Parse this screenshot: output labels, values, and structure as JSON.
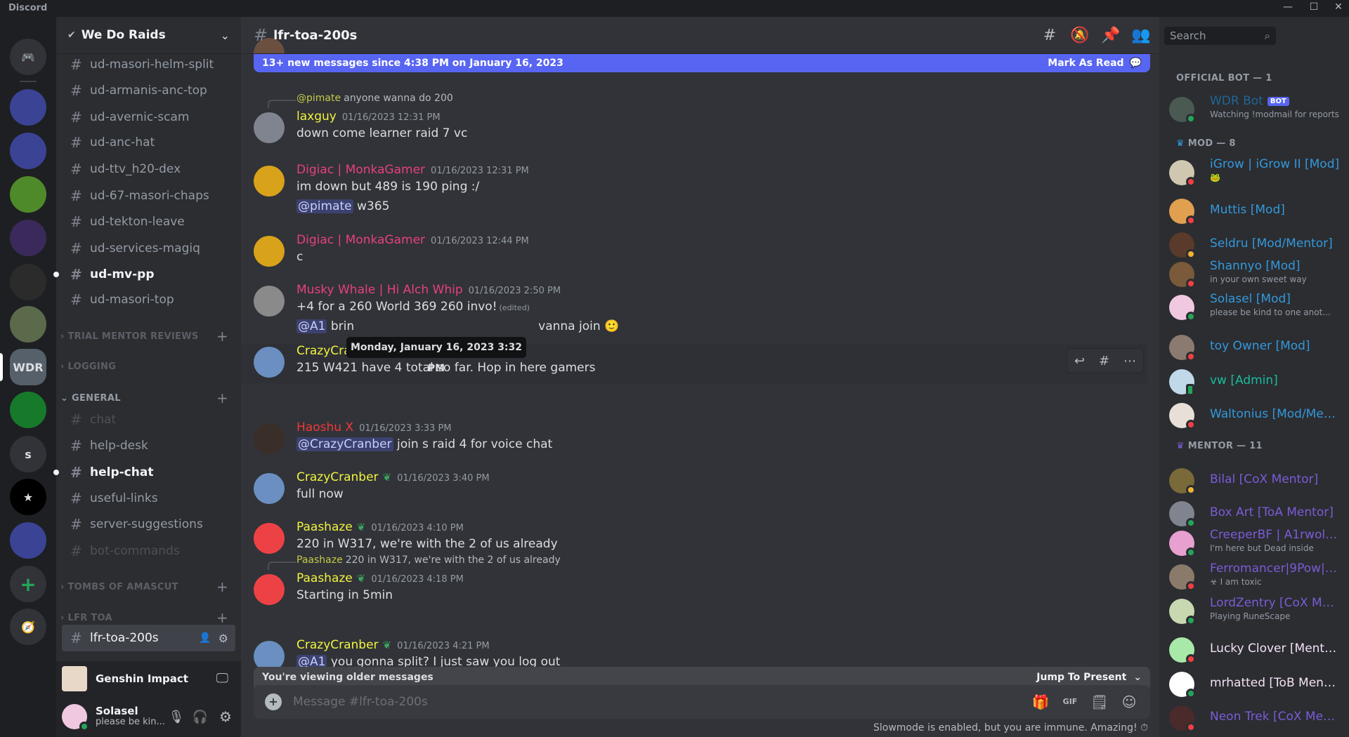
{
  "app": {
    "title": "Discord"
  },
  "colors": {
    "accent": "#5865f2",
    "online": "#23a55a",
    "dnd": "#f23f43",
    "idle": "#f0b232"
  },
  "servers": [
    {
      "name": "home",
      "icon": "discord-logo-icon",
      "color": "#313338",
      "label": ""
    },
    {
      "name": "folder-1",
      "icon": "server-folder-icon",
      "color": "#3b4395",
      "label": ""
    },
    {
      "name": "folder-2",
      "icon": "server-folder-icon",
      "color": "#3b4395",
      "label": ""
    },
    {
      "name": "corn-server",
      "icon": "server-image-icon",
      "color": "#4f8a2a",
      "label": ""
    },
    {
      "name": "kome-server",
      "icon": "server-image-icon",
      "color": "#3a2a5c",
      "label": ""
    },
    {
      "name": "helmet-server",
      "icon": "server-image-icon",
      "color": "#2b2b2b",
      "label": ""
    },
    {
      "name": "green-server",
      "icon": "server-image-icon",
      "color": "#5a6a4a",
      "label": ""
    },
    {
      "name": "We Do Raids",
      "icon": "server-image-icon",
      "color": "#55606a",
      "label": "WDR"
    },
    {
      "name": "brain-server",
      "icon": "server-image-icon",
      "color": "#177a2a",
      "label": ""
    },
    {
      "name": "s-server",
      "icon": "server-initial-icon",
      "color": "#313338",
      "label": "s"
    },
    {
      "name": "star-server",
      "icon": "server-image-icon",
      "color": "#000000",
      "label": "★"
    },
    {
      "name": "folder-3",
      "icon": "server-folder-icon",
      "color": "#3b4395",
      "label": ""
    },
    {
      "name": "add-server",
      "icon": "plus-icon",
      "color": "#313338",
      "label": "+"
    },
    {
      "name": "explore",
      "icon": "compass-icon",
      "color": "#313338",
      "label": "🧭"
    }
  ],
  "guild": {
    "name": "We Do Raids"
  },
  "channels": [
    {
      "type": "channel",
      "name": "ud-masori-helm-split",
      "state": "normal"
    },
    {
      "type": "channel",
      "name": "ud-armanis-anc-top",
      "state": "normal"
    },
    {
      "type": "channel",
      "name": "ud-avernic-scam",
      "state": "normal"
    },
    {
      "type": "channel",
      "name": "ud-anc-hat",
      "state": "normal"
    },
    {
      "type": "channel",
      "name": "ud-ttv_h20-dex",
      "state": "normal"
    },
    {
      "type": "channel",
      "name": "ud-67-masori-chaps",
      "state": "normal"
    },
    {
      "type": "channel",
      "name": "ud-tekton-leave",
      "state": "normal"
    },
    {
      "type": "channel",
      "name": "ud-services-magiq",
      "state": "normal"
    },
    {
      "type": "channel",
      "name": "ud-mv-pp",
      "state": "unread"
    },
    {
      "type": "channel",
      "name": "ud-masori-top",
      "state": "normal"
    },
    {
      "type": "category",
      "name": "TRIAL MENTOR REVIEWS",
      "collapsed": true
    },
    {
      "type": "category",
      "name": "LOGGING",
      "collapsed": true
    },
    {
      "type": "category",
      "name": "GENERAL",
      "collapsed": false
    },
    {
      "type": "channel",
      "name": "chat",
      "state": "muted"
    },
    {
      "type": "channel",
      "name": "help-desk",
      "state": "normal"
    },
    {
      "type": "channel",
      "name": "help-chat",
      "state": "unread"
    },
    {
      "type": "channel",
      "name": "useful-links",
      "state": "normal"
    },
    {
      "type": "channel",
      "name": "server-suggestions",
      "state": "normal"
    },
    {
      "type": "channel",
      "name": "bot-commands",
      "state": "muted"
    },
    {
      "type": "category",
      "name": "TOMBS OF AMASCUT",
      "collapsed": true
    },
    {
      "type": "category",
      "name": "LFR TOA",
      "collapsed": true
    },
    {
      "type": "channel",
      "name": "lfr-toa-200s",
      "state": "selected"
    }
  ],
  "activity": {
    "game": "Genshin Impact"
  },
  "user": {
    "name": "Solasel",
    "status": "please be kin..."
  },
  "header": {
    "channel": "lfr-toa-200s",
    "search_placeholder": "Search"
  },
  "banner": {
    "text": "13+ new messages since 4:38 PM on January 16, 2023",
    "action": "Mark As Read"
  },
  "messages": [
    {
      "author": "",
      "lines": [
        {
          "text": "anyone wanna do 200"
        }
      ],
      "avatar_color": "#6b4f3f"
    },
    {
      "reply": {
        "author": "@pimate",
        "color": "#c7c94a",
        "text": "anyone wanna do 200"
      },
      "author": "laxguy",
      "color": "#f1f33f",
      "time": "01/16/2023 12:31 PM",
      "avatar_color": "#80848e",
      "lines": [
        {
          "text": "down come learner raid 7 vc"
        }
      ]
    },
    {
      "author": "Digiac | MonkaGamer",
      "color": "#e8407e",
      "time": "01/16/2023 12:31 PM",
      "avatar_color": "#d9a21b",
      "lines": [
        {
          "text": "im down but 489 is 190 ping :/"
        },
        {
          "mention": "@pimate",
          "text": " w365"
        }
      ]
    },
    {
      "author": "Digiac | MonkaGamer",
      "color": "#e8407e",
      "time": "01/16/2023 12:44 PM",
      "avatar_color": "#d9a21b",
      "lines": [
        {
          "text": "c"
        }
      ]
    },
    {
      "author": "Musky Whale | Hi Alch Whip",
      "color": "#e8407e",
      "time": "01/16/2023 2:50 PM",
      "avatar_color": "#8a8a8a",
      "lines": [
        {
          "text": "+4 for a 260 World 369 260 invo!",
          "edited": "(edited)"
        },
        {
          "mention": "@A1",
          "text": " brin",
          "tail": "vanna join 🙂"
        }
      ]
    },
    {
      "author": "CrazyCranber",
      "color": "#f1f33f",
      "badge": true,
      "time": "01/16/2023 3:32 PM",
      "avatar_color": "#6a8fc0",
      "hover": true,
      "lines": [
        {
          "text": "215 W421 have 4 total so far. Hop in here gamers"
        }
      ]
    },
    {
      "author": "Haoshu X",
      "color": "#ed3a3a",
      "time": "01/16/2023 3:33 PM",
      "avatar_color": "#3a2e28",
      "lines": [
        {
          "mention": "@CrazyCranber",
          "text": " join s raid 4 for voice chat"
        }
      ]
    },
    {
      "author": "CrazyCranber",
      "color": "#f1f33f",
      "badge": true,
      "time": "01/16/2023 3:40 PM",
      "avatar_color": "#6a8fc0",
      "lines": [
        {
          "text": "full now"
        }
      ]
    },
    {
      "author": "Paashaze",
      "color": "#f1f33f",
      "badge": true,
      "time": "01/16/2023 4:10 PM",
      "avatar_color": "#ed4245",
      "lines": [
        {
          "text": "220 in W317, we're with the 2 of us already"
        }
      ]
    },
    {
      "reply": {
        "author": "Paashaze",
        "color": "#c7c94a",
        "text": "220 in W317, we're with the 2 of us already"
      },
      "author": "Paashaze",
      "color": "#f1f33f",
      "badge": true,
      "time": "01/16/2023 4:18 PM",
      "avatar_color": "#ed4245",
      "lines": [
        {
          "text": "Starting in 5min"
        }
      ]
    },
    {
      "author": "CrazyCranber",
      "color": "#f1f33f",
      "badge": true,
      "time": "01/16/2023 4:21 PM",
      "avatar_color": "#6a8fc0",
      "lines": [
        {
          "mention": "@A1",
          "text": " you gonna split? I just saw you log out"
        }
      ]
    }
  ],
  "tooltip": {
    "text": "Monday, January 16, 2023 3:32 PM"
  },
  "older": {
    "text": "You're viewing older messages",
    "jump": "Jump To Present"
  },
  "composer": {
    "placeholder": "Message #lfr-toa-200s"
  },
  "slowmode": {
    "text": "Slowmode is enabled, but you are immune. Amazing!"
  },
  "members": [
    {
      "type": "group",
      "name": "OFFICIAL BOT — 1"
    },
    {
      "name": "WDR Bot",
      "color": "#206694",
      "bot": "BOT",
      "sub": "Watching !modmail for reports",
      "status": "online",
      "avatar_color": "#4a5a52"
    },
    {
      "type": "group",
      "name": "MOD — 8",
      "icon": "crown-icon"
    },
    {
      "name": "iGrow | iGrow II [Mod]",
      "color": "#3498db",
      "sub": "🐸",
      "status": "dnd",
      "avatar_color": "#cfc7b0"
    },
    {
      "name": "Muttis [Mod]",
      "color": "#3498db",
      "status": "dnd",
      "avatar_color": "#e0a050"
    },
    {
      "name": "Seldru [Mod/Mentor]",
      "color": "#3498db",
      "status": "idle",
      "avatar_color": "#5a3a2a"
    },
    {
      "name": "Shannyo [Mod]",
      "color": "#3498db",
      "sub": "in your own sweet way",
      "status": "dnd",
      "avatar_color": "#7a5a3a"
    },
    {
      "name": "Solasel [Mod]",
      "color": "#3498db",
      "sub": "please be kind to one anot...",
      "status": "online",
      "avatar_color": "#f0c8e0"
    },
    {
      "name": "toy Owner [Mod]",
      "color": "#3498db",
      "status": "dnd",
      "avatar_color": "#8a7a70"
    },
    {
      "name": "vw [Admin]",
      "color": "#1abc9c",
      "status": "mobile",
      "avatar_color": "#c0d8e8"
    },
    {
      "name": "Waltonius [Mod/Ment...",
      "color": "#3498db",
      "status": "dnd",
      "avatar_color": "#e8e0d8"
    },
    {
      "type": "group",
      "name": "MENTOR — 11",
      "icon": "crown-icon"
    },
    {
      "name": "Bilal [CoX Mentor]",
      "color": "#7b5cd6",
      "status": "idle",
      "avatar_color": "#7a6a3a"
    },
    {
      "name": "Box Art [ToA Mentor]",
      "color": "#7b5cd6",
      "status": "online",
      "avatar_color": "#80848e"
    },
    {
      "name": "CreeperBF | A1rwolf [...",
      "color": "#7b5cd6",
      "sub": "I'm here but Dead inside",
      "status": "online",
      "avatar_color": "#e8a0d0"
    },
    {
      "name": "Ferromancer|9Pow|M...",
      "color": "#7b5cd6",
      "sub": "☣ I am toxic",
      "status": "dnd",
      "avatar_color": "#8a7a6a"
    },
    {
      "name": "LordZentry [CoX Men...",
      "color": "#7b5cd6",
      "sub": "Playing RuneScape",
      "status": "online",
      "avatar_color": "#c8d8b0"
    },
    {
      "name": "Lucky Clover [Mentor]",
      "color": "#f5e1f5",
      "status": "dnd",
      "avatar_color": "#a8e8a8"
    },
    {
      "name": "mrhatted [ToB Mentor]",
      "color": "#f5e1f5",
      "status": "online",
      "avatar_color": "#ffffff"
    },
    {
      "name": "Neon Trek [CoX Ment...",
      "color": "#7b5cd6",
      "status": "dnd",
      "avatar_color": "#4a2a2a"
    }
  ]
}
